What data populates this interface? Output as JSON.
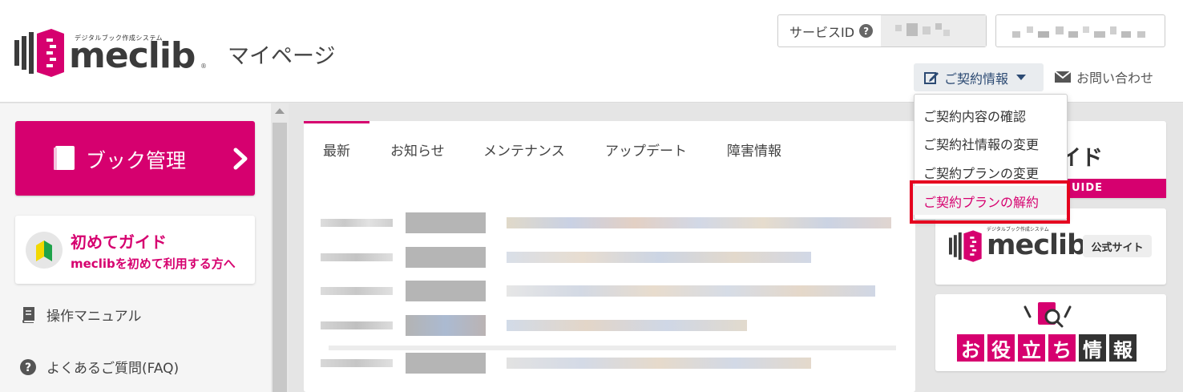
{
  "header": {
    "logo_tagline": "デジタルブック作成システム",
    "logo_text": "meclib",
    "logo_reg": "®",
    "page_title": "マイページ",
    "service_label": "サービスID",
    "help_glyph": "?",
    "contract_menu_label": "ご契約情報",
    "inquiry_label": "お問い合わせ"
  },
  "sidebar": {
    "book_button_label": "ブック管理",
    "guide_card": {
      "title": "初めてガイド",
      "subtitle": "meclibを初めて利用する方へ"
    },
    "links": [
      {
        "label": "操作マニュアル",
        "icon": "manual-book-icon"
      },
      {
        "label": "よくあるご質問(FAQ)",
        "icon": "question-circle-icon"
      }
    ]
  },
  "main": {
    "tabs": [
      "最新",
      "お知らせ",
      "メンテナンス",
      "アップデート",
      "障害情報"
    ],
    "active_tab": "最新"
  },
  "right_column": {
    "guide_banner_text": "ジガイド",
    "guide_banner_strip": "UIDE",
    "official_tagline": "デジタルブック作成システム",
    "official_logo_text": "meclib",
    "official_badge": "公式サイト",
    "tips_chars": [
      "お",
      "役",
      "立",
      "ち",
      "情",
      "報"
    ]
  },
  "dropdown": {
    "items": [
      "ご契約内容の確認",
      "ご契約社情報の変更",
      "ご契約プランの変更",
      "ご契約プランの解約"
    ],
    "highlighted_index": 3
  },
  "colors": {
    "brand_magenta": "#d6006f",
    "highlight_red": "#e5001f",
    "contract_text": "#2c4a73",
    "tips_dark": "#333333"
  }
}
